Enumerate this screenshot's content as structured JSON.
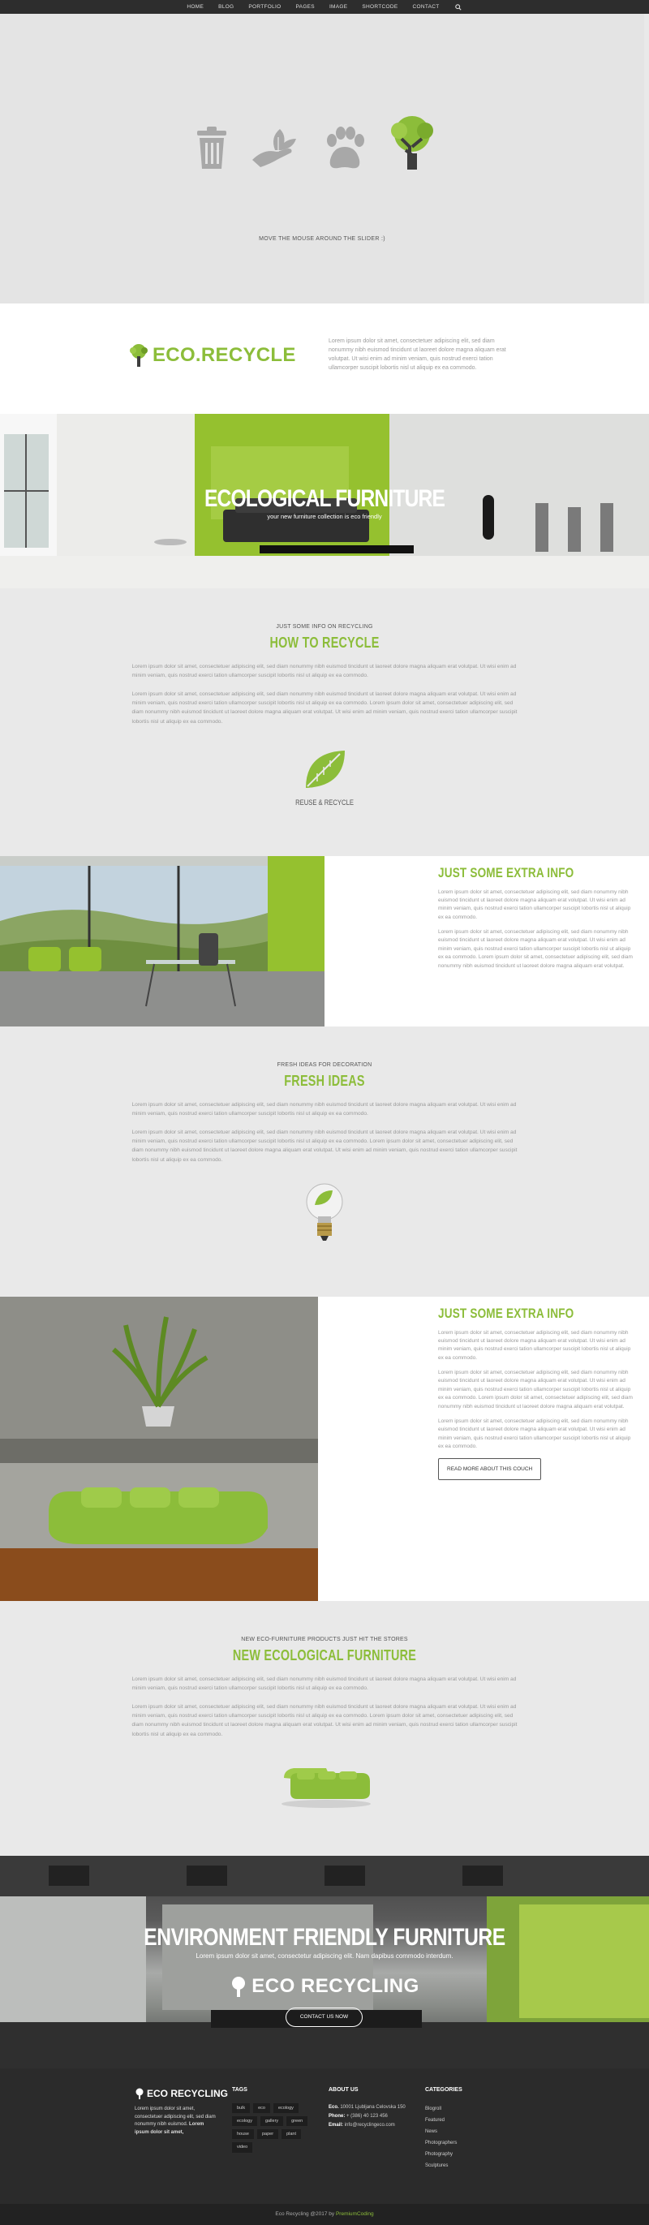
{
  "nav": {
    "items": [
      "HOME",
      "BLOG",
      "PORTFOLIO",
      "PAGES",
      "IMAGE",
      "SHORTCODE",
      "CONTACT"
    ]
  },
  "slider": {
    "icons": [
      "trash-can-icon",
      "hand-leaf-icon",
      "paw-print-icon",
      "tree-icon"
    ],
    "hint": "MOVE THE MOUSE AROUND THE SLIDER :)"
  },
  "logo_band": {
    "brand": "ECO.RECYCLE",
    "intro": "Lorem ipsum dolor sit amet, consectetuer adipiscing elit, sed diam nonummy nibh euismod tincidunt ut laoreet dolore magna aliquam erat volutpat. Ut wisi enim ad minim veniam, quis nostrud exerci tation ullamcorper suscipit lobortis nisl ut aliquip ex ea commodo."
  },
  "hero1": {
    "title": "ECOLOGICAL FURNITURE",
    "subtitle": "your new furniture collection is eco friendly"
  },
  "recycle": {
    "kicker": "JUST SOME INFO ON RECYCLING",
    "title": "HOW TO RECYCLE",
    "para1": "Lorem ipsum dolor sit amet, consectetuer adipiscing elit, sed diam nonummy nibh euismod tincidunt ut laoreet dolore magna aliquam erat volutpat. Ut wisi enim ad minim veniam, quis nostrud exerci tation ullamcorper suscipit lobortis nisl ut aliquip ex ea commodo.",
    "para2": "Lorem ipsum dolor sit amet, consectetuer adipiscing elit, sed diam nonummy nibh euismod tincidunt ut laoreet dolore magna aliquam erat volutpat. Ut wisi enim ad minim veniam, quis nostrud exerci tation ullamcorper suscipit lobortis nisl ut aliquip ex ea commodo. Lorem ipsum dolor sit amet, consectetuer adipiscing elit, sed diam nonummy nibh euismod tincidunt ut laoreet dolore magna aliquam erat volutpat. Ut wisi enim ad minim veniam, quis nostrud exerci tation ullamcorper suscipit lobortis nisl ut aliquip ex ea commodo.",
    "icon_caption": "REUSE & RECYCLE"
  },
  "extra1": {
    "title": "JUST SOME EXTRA INFO",
    "para1": "Lorem ipsum dolor sit amet, consectetuer adipiscing elit, sed diam nonummy nibh euismod tincidunt ut laoreet dolore magna aliquam erat volutpat. Ut wisi enim ad minim veniam, quis nostrud exerci tation ullamcorper suscipit lobortis nisl ut aliquip ex ea commodo.",
    "para2": "Lorem ipsum dolor sit amet, consectetuer adipiscing elit, sed diam nonummy nibh euismod tincidunt ut laoreet dolore magna aliquam erat volutpat. Ut wisi enim ad minim veniam, quis nostrud exerci tation ullamcorper suscipit lobortis nisl ut aliquip ex ea commodo. Lorem ipsum dolor sit amet, consectetuer adipiscing elit, sed diam nonummy nibh euismod tincidunt ut laoreet dolore magna aliquam erat volutpat."
  },
  "fresh": {
    "kicker": "FRESH IDEAS FOR DECORATION",
    "title": "FRESH IDEAS",
    "para1": "Lorem ipsum dolor sit amet, consectetuer adipiscing elit, sed diam nonummy nibh euismod tincidunt ut laoreet dolore magna aliquam erat volutpat. Ut wisi enim ad minim veniam, quis nostrud exerci tation ullamcorper suscipit lobortis nisl ut aliquip ex ea commodo.",
    "para2": "Lorem ipsum dolor sit amet, consectetuer adipiscing elit, sed diam nonummy nibh euismod tincidunt ut laoreet dolore magna aliquam erat volutpat. Ut wisi enim ad minim veniam, quis nostrud exerci tation ullamcorper suscipit lobortis nisl ut aliquip ex ea commodo. Lorem ipsum dolor sit amet, consectetuer adipiscing elit, sed diam nonummy nibh euismod tincidunt ut laoreet dolore magna aliquam erat volutpat. Ut wisi enim ad minim veniam, quis nostrud exerci tation ullamcorper suscipit lobortis nisl ut aliquip ex ea commodo."
  },
  "extra2": {
    "title": "JUST SOME EXTRA INFO",
    "para1": "Lorem ipsum dolor sit amet, consectetuer adipiscing elit, sed diam nonummy nibh euismod tincidunt ut laoreet dolore magna aliquam erat volutpat. Ut wisi enim ad minim veniam, quis nostrud exerci tation ullamcorper suscipit lobortis nisl ut aliquip ex ea commodo.",
    "para2": "Lorem ipsum dolor sit amet, consectetuer adipiscing elit, sed diam nonummy nibh euismod tincidunt ut laoreet dolore magna aliquam erat volutpat. Ut wisi enim ad minim veniam, quis nostrud exerci tation ullamcorper suscipit lobortis nisl ut aliquip ex ea commodo. Lorem ipsum dolor sit amet, consectetuer adipiscing elit, sed diam nonummy nibh euismod tincidunt ut laoreet dolore magna aliquam erat volutpat.",
    "para3": "Lorem ipsum dolor sit amet, consectetuer adipiscing elit, sed diam nonummy nibh euismod tincidunt ut laoreet dolore magna aliquam erat volutpat. Ut wisi enim ad minim veniam, quis nostrud exerci tation ullamcorper suscipit lobortis nisl ut aliquip ex ea commodo.",
    "button": "READ MORE ABOUT THIS COUCH"
  },
  "newfurn": {
    "kicker": "NEW ECO-FURNITURE PRODUCTS JUST HIT THE STORES",
    "title": "NEW ECOLOGICAL FURNITURE",
    "para1": "Lorem ipsum dolor sit amet, consectetuer adipiscing elit, sed diam nonummy nibh euismod tincidunt ut laoreet dolore magna aliquam erat volutpat. Ut wisi enim ad minim veniam, quis nostrud exerci tation ullamcorper suscipit lobortis nisl ut aliquip ex ea commodo.",
    "para2": "Lorem ipsum dolor sit amet, consectetuer adipiscing elit, sed diam nonummy nibh euismod tincidunt ut laoreet dolore magna aliquam erat volutpat. Ut wisi enim ad minim veniam, quis nostrud exerci tation ullamcorper suscipit lobortis nisl ut aliquip ex ea commodo. Lorem ipsum dolor sit amet, consectetuer adipiscing elit, sed diam nonummy nibh euismod tincidunt ut laoreet dolore magna aliquam erat volutpat. Ut wisi enim ad minim veniam, quis nostrud exerci tation ullamcorper suscipit lobortis nisl ut aliquip ex ea commodo."
  },
  "hero2": {
    "title": "ENVIRONMENT FRIENDLY FURNITURE",
    "subtitle": "Lorem ipsum dolor sit amet, consectetur adipiscing elit. Nam dapibus commodo interdum.",
    "brand": "ECO RECYCLING",
    "button": "CONTACT US NOW"
  },
  "footer": {
    "brand": "ECO RECYCLING",
    "about": "Lorem ipsum dolor sit amet, consectetuer adipiscing elit, sed diam nonummy nibh euismod.",
    "about_bold": "Lorem ipsum dolor sit amet,",
    "tags_title": "TAGS",
    "tags": [
      "bulk",
      "eco",
      "ecology",
      "ecology",
      "gallery",
      "green",
      "house",
      "paper",
      "plant",
      "video"
    ],
    "about_title": "ABOUT US",
    "address_label": "Eco.",
    "address": "10001 Ljubljana Celovska 150",
    "phone_label": "Phone:",
    "phone": "+ (386) 40 123 456",
    "email_label": "Email:",
    "email": "info@recyclingeco.com",
    "cat_title": "CATEGORIES",
    "categories": [
      "Blogroll",
      "Featured",
      "News",
      "Photographers",
      "Photography",
      "Sculptures"
    ]
  },
  "copyright": {
    "text": "Eco Recycling @2017 by ",
    "author": "PremiumCoding"
  },
  "colors": {
    "accent": "#8cbd3a",
    "dark": "#2b2b2b",
    "bg": "#e9e9e9"
  }
}
